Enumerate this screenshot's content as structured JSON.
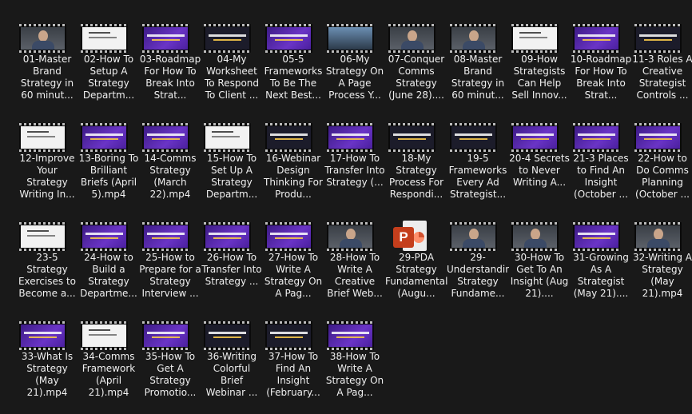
{
  "files": [
    {
      "label": "01-Master Brand Strategy in 60 minut...",
      "thumb": "person"
    },
    {
      "label": "02-How To Setup A Strategy Departm...",
      "thumb": "white"
    },
    {
      "label": "03-Roadmap For How To Break Into Strat...",
      "thumb": "purple"
    },
    {
      "label": "04-My Worksheet To Respond To Client ...",
      "thumb": "dark"
    },
    {
      "label": "05-5 Frameworks To Be The Next Best...",
      "thumb": "purple"
    },
    {
      "label": "06-My Strategy On A Page Process Y...",
      "thumb": "blue"
    },
    {
      "label": "07-Conquer Comms Strategy (June 28)....",
      "thumb": "person"
    },
    {
      "label": "08-Master Brand Strategy in 60 minut...",
      "thumb": "person"
    },
    {
      "label": "09-How Strategists Can Help Sell Innov...",
      "thumb": "white"
    },
    {
      "label": "10-Roadmap For How To Break Into Strat...",
      "thumb": "purple"
    },
    {
      "label": "11-3 Roles A Creative Strategist Controls ...",
      "thumb": "dark"
    },
    {
      "label": "12-Improve Your Strategy Writing In...",
      "thumb": "white"
    },
    {
      "label": "13-Boring To Brilliant Briefs (April 5).mp4",
      "thumb": "purple"
    },
    {
      "label": "14-Comms Strategy (March 22).mp4",
      "thumb": "purple"
    },
    {
      "label": "15-How To Set Up A Strategy Departm...",
      "thumb": "white"
    },
    {
      "label": "16-Webinar Design Thinking For Produ...",
      "thumb": "dark"
    },
    {
      "label": "17-How To Transfer Into Strategy (...",
      "thumb": "purple"
    },
    {
      "label": "18-My Strategy Process For Respondi...",
      "thumb": "dark"
    },
    {
      "label": "19-5 Frameworks Every Ad Strategist...",
      "thumb": "dark"
    },
    {
      "label": "20-4 Secrets to Never Writing A...",
      "thumb": "purple"
    },
    {
      "label": "21-3 Places to Find An Insight (October ...",
      "thumb": "purple"
    },
    {
      "label": "22-How to Do Comms Planning (October ...",
      "thumb": "purple"
    },
    {
      "label": "23-5 Strategy Exercises to Become a...",
      "thumb": "white"
    },
    {
      "label": "24-How to Build a Strategy Departme...",
      "thumb": "purple"
    },
    {
      "label": "25-How to Prepare for a Strategy Interview ...",
      "thumb": "purple"
    },
    {
      "label": "26-How To Transfer Into Strategy ...",
      "thumb": "purple"
    },
    {
      "label": "27-How To Write A Strategy On A Pag...",
      "thumb": "purple"
    },
    {
      "label": "28-How To Write A Creative Brief Web...",
      "thumb": "person"
    },
    {
      "label": "29-PDA Strategy Fundamentals (Augu...",
      "thumb": "ppt"
    },
    {
      "label": "29-Understanding Strategy Fundame...",
      "thumb": "person"
    },
    {
      "label": "30-How To Get To An Insight (Aug 21)....",
      "thumb": "person"
    },
    {
      "label": "31-Growing As A Strategist (May 21)....",
      "thumb": "purple"
    },
    {
      "label": "32-Writing A Strategy (May 21).mp4",
      "thumb": "person"
    },
    {
      "label": "33-What Is Strategy (May 21).mp4",
      "thumb": "purple"
    },
    {
      "label": "34-Comms Framework (April 21).mp4",
      "thumb": "white"
    },
    {
      "label": "35-How To Get A Strategy Promotio...",
      "thumb": "purple"
    },
    {
      "label": "36-Writing Colorful Brief Webinar ...",
      "thumb": "dark"
    },
    {
      "label": "37-How To Find An Insight (February...",
      "thumb": "dark"
    },
    {
      "label": "38-How To Write A Strategy On A Pag...",
      "thumb": "purple"
    }
  ]
}
